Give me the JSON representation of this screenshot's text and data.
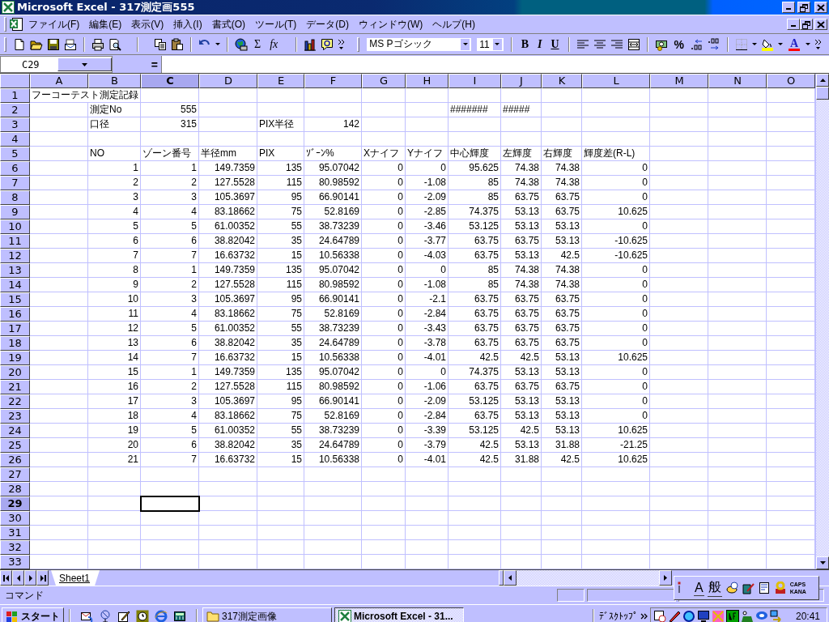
{
  "window": {
    "title": "Microsoft Excel - 317測定画555"
  },
  "menu": [
    "ファイル(F)",
    "編集(E)",
    "表示(V)",
    "挿入(I)",
    "書式(O)",
    "ツール(T)",
    "データ(D)",
    "ウィンドウ(W)",
    "ヘルプ(H)"
  ],
  "toolbar": {
    "symbols": [
      "Σ",
      "fx",
      "B",
      "I",
      "U",
      "%",
      "A"
    ],
    "font": "MS Pゴシック",
    "size": "11"
  },
  "formula_bar": {
    "name_box": "C29",
    "equals": "="
  },
  "columns": [
    {
      "label": "A",
      "selected": false
    },
    {
      "label": "B",
      "selected": false
    },
    {
      "label": "C",
      "selected": true
    },
    {
      "label": "D",
      "selected": false
    },
    {
      "label": "E",
      "selected": false
    },
    {
      "label": "F",
      "selected": false
    },
    {
      "label": "G",
      "selected": false
    },
    {
      "label": "H",
      "selected": false
    },
    {
      "label": "I",
      "selected": false
    },
    {
      "label": "J",
      "selected": false
    },
    {
      "label": "K",
      "selected": false
    },
    {
      "label": "L",
      "selected": false
    },
    {
      "label": "M",
      "selected": false
    },
    {
      "label": "N",
      "selected": false
    },
    {
      "label": "O",
      "selected": false
    }
  ],
  "rows": [
    {
      "header": "1",
      "selected": false,
      "kind": "cells",
      "cells": [
        {
          "kind": "text",
          "text": "フーコーテスト測定記録"
        }
      ]
    },
    {
      "header": "2",
      "selected": false,
      "kind": "cells",
      "cells": [
        {
          "kind": "blank"
        },
        {
          "kind": "text",
          "text": "測定No"
        },
        {
          "kind": "number",
          "text": "555"
        },
        {
          "kind": "blank"
        },
        {
          "kind": "blank"
        },
        {
          "kind": "blank"
        },
        {
          "kind": "blank"
        },
        {
          "kind": "blank"
        },
        {
          "kind": "text",
          "text": "#######"
        },
        {
          "kind": "text",
          "text": "#####"
        }
      ]
    },
    {
      "header": "3",
      "selected": false,
      "kind": "cells",
      "cells": [
        {
          "kind": "blank"
        },
        {
          "kind": "text",
          "text": "口径"
        },
        {
          "kind": "number",
          "text": "315"
        },
        {
          "kind": "blank"
        },
        {
          "kind": "text",
          "text": "PIX半径"
        },
        {
          "kind": "number",
          "text": "142"
        }
      ]
    },
    {
      "header": "4",
      "selected": false,
      "kind": "cells",
      "cells": []
    },
    {
      "header": "5",
      "selected": false,
      "kind": "cells",
      "cells": [
        {
          "kind": "blank"
        },
        {
          "kind": "text",
          "text": "NO"
        },
        {
          "kind": "text",
          "text": "ゾーン番号"
        },
        {
          "kind": "text",
          "text": "半径mm"
        },
        {
          "kind": "text",
          "text": " PIX"
        },
        {
          "kind": "text",
          "text": "ｿﾞｰﾝ%"
        },
        {
          "kind": "text",
          "text": "Xナイフ"
        },
        {
          "kind": "text",
          "text": "Yナイフ"
        },
        {
          "kind": "text",
          "text": "中心輝度"
        },
        {
          "kind": "text",
          "text": "左輝度"
        },
        {
          "kind": "text",
          "text": "右輝度"
        },
        {
          "kind": "text",
          "text": "輝度差(R-L)"
        }
      ]
    },
    {
      "header": "6",
      "selected": false,
      "kind": "data",
      "values": [
        "1",
        "1",
        "149.7359",
        "135",
        "95.07042",
        "0",
        "0",
        "95.625",
        "74.38",
        "74.38",
        "0"
      ]
    },
    {
      "header": "7",
      "selected": false,
      "kind": "data",
      "values": [
        "2",
        "2",
        "127.5528",
        "115",
        "80.98592",
        "0",
        "-1.08",
        "85",
        "74.38",
        "74.38",
        "0"
      ]
    },
    {
      "header": "8",
      "selected": false,
      "kind": "data",
      "values": [
        "3",
        "3",
        "105.3697",
        "95",
        "66.90141",
        "0",
        "-2.09",
        "85",
        "63.75",
        "63.75",
        "0"
      ]
    },
    {
      "header": "9",
      "selected": false,
      "kind": "data",
      "values": [
        "4",
        "4",
        "83.18662",
        "75",
        "52.8169",
        "0",
        "-2.85",
        "74.375",
        "53.13",
        "63.75",
        "10.625"
      ]
    },
    {
      "header": "10",
      "selected": false,
      "kind": "data",
      "values": [
        "5",
        "5",
        "61.00352",
        "55",
        "38.73239",
        "0",
        "-3.46",
        "53.125",
        "53.13",
        "53.13",
        "0"
      ]
    },
    {
      "header": "11",
      "selected": false,
      "kind": "data",
      "values": [
        "6",
        "6",
        "38.82042",
        "35",
        "24.64789",
        "0",
        "-3.77",
        "63.75",
        "63.75",
        "53.13",
        "-10.625"
      ]
    },
    {
      "header": "12",
      "selected": false,
      "kind": "data",
      "values": [
        "7",
        "7",
        "16.63732",
        "15",
        "10.56338",
        "0",
        "-4.03",
        "63.75",
        "53.13",
        "42.5",
        "-10.625"
      ]
    },
    {
      "header": "13",
      "selected": false,
      "kind": "data",
      "values": [
        "8",
        "1",
        "149.7359",
        "135",
        "95.07042",
        "0",
        "0",
        "85",
        "74.38",
        "74.38",
        "0"
      ]
    },
    {
      "header": "14",
      "selected": false,
      "kind": "data",
      "values": [
        "9",
        "2",
        "127.5528",
        "115",
        "80.98592",
        "0",
        "-1.08",
        "85",
        "74.38",
        "74.38",
        "0"
      ]
    },
    {
      "header": "15",
      "selected": false,
      "kind": "data",
      "values": [
        "10",
        "3",
        "105.3697",
        "95",
        "66.90141",
        "0",
        "-2.1",
        "63.75",
        "63.75",
        "63.75",
        "0"
      ]
    },
    {
      "header": "16",
      "selected": false,
      "kind": "data",
      "values": [
        "11",
        "4",
        "83.18662",
        "75",
        "52.8169",
        "0",
        "-2.84",
        "63.75",
        "63.75",
        "63.75",
        "0"
      ]
    },
    {
      "header": "17",
      "selected": false,
      "kind": "data",
      "values": [
        "12",
        "5",
        "61.00352",
        "55",
        "38.73239",
        "0",
        "-3.43",
        "63.75",
        "63.75",
        "63.75",
        "0"
      ]
    },
    {
      "header": "18",
      "selected": false,
      "kind": "data",
      "values": [
        "13",
        "6",
        "38.82042",
        "35",
        "24.64789",
        "0",
        "-3.78",
        "63.75",
        "63.75",
        "63.75",
        "0"
      ]
    },
    {
      "header": "19",
      "selected": false,
      "kind": "data",
      "values": [
        "14",
        "7",
        "16.63732",
        "15",
        "10.56338",
        "0",
        "-4.01",
        "42.5",
        "42.5",
        "53.13",
        "10.625"
      ]
    },
    {
      "header": "20",
      "selected": false,
      "kind": "data",
      "values": [
        "15",
        "1",
        "149.7359",
        "135",
        "95.07042",
        "0",
        "0",
        "74.375",
        "53.13",
        "53.13",
        "0"
      ]
    },
    {
      "header": "21",
      "selected": false,
      "kind": "data",
      "values": [
        "16",
        "2",
        "127.5528",
        "115",
        "80.98592",
        "0",
        "-1.06",
        "63.75",
        "63.75",
        "63.75",
        "0"
      ]
    },
    {
      "header": "22",
      "selected": false,
      "kind": "data",
      "values": [
        "17",
        "3",
        "105.3697",
        "95",
        "66.90141",
        "0",
        "-2.09",
        "53.125",
        "53.13",
        "53.13",
        "0"
      ]
    },
    {
      "header": "23",
      "selected": false,
      "kind": "data",
      "values": [
        "18",
        "4",
        "83.18662",
        "75",
        "52.8169",
        "0",
        "-2.84",
        "63.75",
        "53.13",
        "53.13",
        "0"
      ]
    },
    {
      "header": "24",
      "selected": false,
      "kind": "data",
      "values": [
        "19",
        "5",
        "61.00352",
        "55",
        "38.73239",
        "0",
        "-3.39",
        "53.125",
        "42.5",
        "53.13",
        "10.625"
      ]
    },
    {
      "header": "25",
      "selected": false,
      "kind": "data",
      "values": [
        "20",
        "6",
        "38.82042",
        "35",
        "24.64789",
        "0",
        "-3.79",
        "42.5",
        "53.13",
        "31.88",
        "-21.25"
      ]
    },
    {
      "header": "26",
      "selected": false,
      "kind": "data",
      "values": [
        "21",
        "7",
        "16.63732",
        "15",
        "10.56338",
        "0",
        "-4.01",
        "42.5",
        "31.88",
        "42.5",
        "10.625"
      ]
    },
    {
      "header": "27",
      "selected": false,
      "kind": "cells",
      "cells": []
    },
    {
      "header": "28",
      "selected": false,
      "kind": "cells",
      "cells": []
    },
    {
      "header": "29",
      "selected": true,
      "kind": "cells",
      "cells": []
    },
    {
      "header": "30",
      "selected": false,
      "kind": "cells",
      "cells": []
    },
    {
      "header": "31",
      "selected": false,
      "kind": "cells",
      "cells": []
    },
    {
      "header": "32",
      "selected": false,
      "kind": "cells",
      "cells": []
    },
    {
      "header": "33",
      "selected": false,
      "kind": "cells",
      "cells": []
    }
  ],
  "sheet_tabs": [
    {
      "label": "Sheet1",
      "selected": true
    }
  ],
  "status_bar": {
    "mode": "コマンド"
  },
  "ime_bar": {
    "input_mode": "A",
    "conversion": "般",
    "caps": "CAPS",
    "kana": "KANA"
  },
  "taskbar": {
    "start": "スタート",
    "tasks": [
      {
        "label": "317測定画像",
        "selected": false
      },
      {
        "label": "Microsoft Excel - 31...",
        "selected": true
      }
    ],
    "toolbar_label": "ﾃﾞｽｸﾄｯﾌﾟ",
    "clock": "20:41"
  }
}
